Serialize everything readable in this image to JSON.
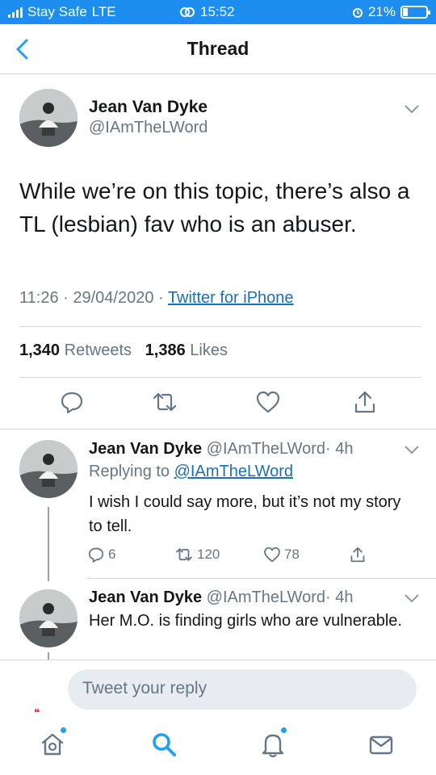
{
  "status": {
    "carrier": "Stay Safe",
    "network": "LTE",
    "time": "15:52",
    "battery_text": "21%",
    "battery_level": 0.21,
    "bar_color": "#1d8ef0"
  },
  "nav": {
    "title": "Thread",
    "back_icon": "chevron-left-icon"
  },
  "tweet": {
    "name": "Jean Van Dyke",
    "handle": "@IAmTheLWord",
    "text": "While we’re on this topic, there’s also a TL (lesbian) fav who is an abuser.",
    "time": "11:26",
    "separator": "·",
    "date": "29/04/2020",
    "source": "Twitter for iPhone",
    "retweets_count": "1,340",
    "retweets_label": "Retweets",
    "likes_count": "1,386",
    "likes_label": "Likes",
    "actions": [
      "reply-icon",
      "retweet-icon",
      "like-icon",
      "share-icon"
    ]
  },
  "replies": [
    {
      "name": "Jean Van Dyke",
      "handle": "@IAmTheLWord",
      "age": "· 4h",
      "replying_label": "Replying to",
      "replying_to": "@IAmTheLWord",
      "text": "I wish I could say more, but it’s not my story to tell.",
      "reply_count": "6",
      "retweet_count": "120",
      "like_count": "78"
    },
    {
      "name": "Jean Van Dyke",
      "handle": "@IAmTheLWord",
      "age": "· 4h",
      "text": "Her M.O. is finding girls who are vulnerable."
    }
  ],
  "composer": {
    "placeholder": "Tweet your reply",
    "quote_mark": "❝"
  },
  "tabs": [
    "home-icon",
    "search-icon",
    "notifications-icon",
    "messages-icon"
  ],
  "colors": {
    "accent": "#1da1f2",
    "link": "#1b6fc0",
    "secondary_text": "#657786"
  }
}
